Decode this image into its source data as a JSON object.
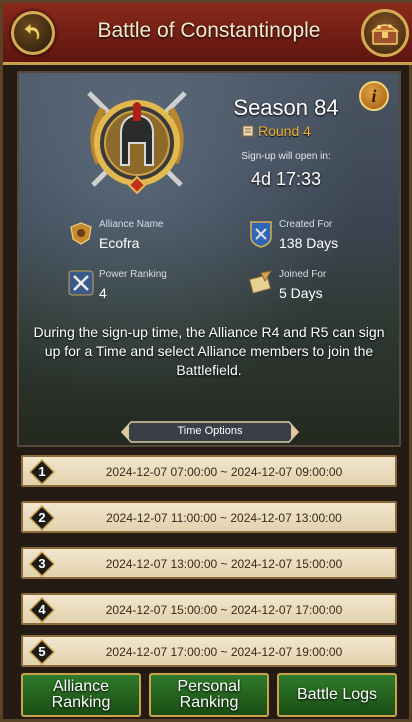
{
  "header": {
    "title": "Battle of Constantinople"
  },
  "season": {
    "title": "Season 84",
    "round": "Round 4",
    "signup_label": "Sign-up will open in:",
    "countdown": "4d 17:33"
  },
  "stats": {
    "alliance_name_label": "Alliance Name",
    "alliance_name": "Ecofra",
    "created_for_label": "Created For",
    "created_for": "138 Days",
    "power_ranking_label": "Power Ranking",
    "power_ranking": "4",
    "joined_for_label": "Joined For",
    "joined_for": "5 Days"
  },
  "description": "During the sign-up time, the Alliance R4 and R5 can sign up for a Time and select Alliance members to join the Battlefield.",
  "time_options_label": "Time Options",
  "slots": [
    {
      "num": "1",
      "range": "2024-12-07 07:00:00 ~ 2024-12-07 09:00:00"
    },
    {
      "num": "2",
      "range": "2024-12-07 11:00:00 ~ 2024-12-07 13:00:00"
    },
    {
      "num": "3",
      "range": "2024-12-07 13:00:00 ~ 2024-12-07 15:00:00"
    },
    {
      "num": "4",
      "range": "2024-12-07 15:00:00 ~ 2024-12-07 17:00:00"
    },
    {
      "num": "5",
      "range": "2024-12-07 17:00:00 ~ 2024-12-07 19:00:00"
    }
  ],
  "buttons": {
    "alliance_ranking": "Alliance\nRanking",
    "personal_ranking": "Personal\nRanking",
    "battle_logs": "Battle Logs"
  },
  "icons": {
    "back": "back-arrow-icon",
    "chest": "treasure-chest-icon",
    "info": "info-icon",
    "emblem": "spartan-helmet-emblem-icon"
  },
  "colors": {
    "header": "#8a2a1c",
    "gold": "#c9a24d",
    "round": "#f2b234",
    "button_green": "#2f7a2a",
    "slot_bg": "#f1e6cd"
  }
}
